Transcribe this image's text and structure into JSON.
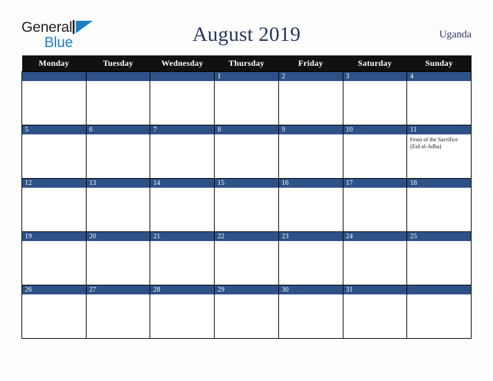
{
  "brand": {
    "name_part1": "General",
    "name_part2": "Blue",
    "mark": "triangle-icon",
    "color_dark": "#231f20",
    "color_blue": "#1c7fc4"
  },
  "header": {
    "title": "August 2019",
    "region": "Uganda",
    "title_color": "#26375e"
  },
  "calendar": {
    "header_bg": "#111111",
    "header_fg": "#ffffff",
    "daybar_bg": "#2e5288",
    "daybar_fg": "#ffffff",
    "cell_bg": "#ffffff",
    "border_color": "#000000",
    "weekdays": [
      "Monday",
      "Tuesday",
      "Wednesday",
      "Thursday",
      "Friday",
      "Saturday",
      "Sunday"
    ],
    "weeks": [
      [
        {
          "day": "",
          "event": ""
        },
        {
          "day": "",
          "event": ""
        },
        {
          "day": "",
          "event": ""
        },
        {
          "day": "1",
          "event": ""
        },
        {
          "day": "2",
          "event": ""
        },
        {
          "day": "3",
          "event": ""
        },
        {
          "day": "4",
          "event": ""
        }
      ],
      [
        {
          "day": "5",
          "event": ""
        },
        {
          "day": "6",
          "event": ""
        },
        {
          "day": "7",
          "event": ""
        },
        {
          "day": "8",
          "event": ""
        },
        {
          "day": "9",
          "event": ""
        },
        {
          "day": "10",
          "event": ""
        },
        {
          "day": "11",
          "event": "Feast of the Sacrifice (Eid al-Adha)"
        }
      ],
      [
        {
          "day": "12",
          "event": ""
        },
        {
          "day": "13",
          "event": ""
        },
        {
          "day": "14",
          "event": ""
        },
        {
          "day": "15",
          "event": ""
        },
        {
          "day": "16",
          "event": ""
        },
        {
          "day": "17",
          "event": ""
        },
        {
          "day": "18",
          "event": ""
        }
      ],
      [
        {
          "day": "19",
          "event": ""
        },
        {
          "day": "20",
          "event": ""
        },
        {
          "day": "21",
          "event": ""
        },
        {
          "day": "22",
          "event": ""
        },
        {
          "day": "23",
          "event": ""
        },
        {
          "day": "24",
          "event": ""
        },
        {
          "day": "25",
          "event": ""
        }
      ],
      [
        {
          "day": "26",
          "event": ""
        },
        {
          "day": "27",
          "event": ""
        },
        {
          "day": "28",
          "event": ""
        },
        {
          "day": "29",
          "event": ""
        },
        {
          "day": "30",
          "event": ""
        },
        {
          "day": "31",
          "event": ""
        },
        {
          "day": "",
          "event": ""
        }
      ]
    ]
  }
}
